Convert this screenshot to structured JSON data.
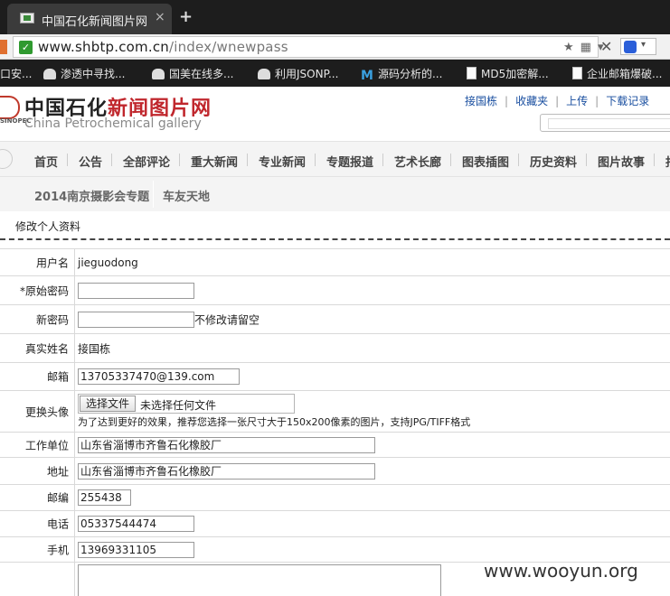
{
  "browser": {
    "tab_title": "中国石化新闻图片网",
    "tab_close": "×",
    "new_tab": "+",
    "secure_icon": "✓",
    "url_host": "www.shbtp.com.cn",
    "url_path": "/index/wnewpass",
    "bookmarks": [
      {
        "label": "口安...",
        "icon": "cloud-icon"
      },
      {
        "label": "渗透中寻找...",
        "icon": "cloud-icon"
      },
      {
        "label": "国美在线多...",
        "icon": "cloud-icon"
      },
      {
        "label": "利用JSONP...",
        "icon": "cloud-icon"
      },
      {
        "label": "源码分析的...",
        "icon": "m-icon"
      },
      {
        "label": "MD5加密解...",
        "icon": "doc-icon"
      },
      {
        "label": "企业邮箱爆破...",
        "icon": "doc-icon"
      }
    ]
  },
  "site": {
    "logo_mark": "SINOPEC",
    "logo_cn_black": "中国石化",
    "logo_cn_red": "新闻图片网",
    "logo_en": "China Petrochemical gallery",
    "top_links": [
      "接国栋",
      "收藏夹",
      "上传",
      "下载记录"
    ],
    "nav": [
      "首页",
      "公告",
      "全部评论",
      "重大新闻",
      "专业新闻",
      "专题报道",
      "艺术长廊",
      "图表插图",
      "历史资料",
      "图片故事",
      "报"
    ],
    "subnav": [
      "2014南京摄影会专题",
      "车友天地"
    ]
  },
  "page": {
    "breadcrumb": "修改个人资料",
    "fields": {
      "username_label": "用户名",
      "username_value": "jieguodong",
      "old_password_label": "*原始密码",
      "old_password_value": "",
      "new_password_label": "新密码",
      "new_password_value": "",
      "new_password_hint": "不修改请留空",
      "realname_label": "真实姓名",
      "realname_value": "接国栋",
      "email_label": "邮箱",
      "email_value": "13705337470@139.com",
      "avatar_label": "更换头像",
      "avatar_button": "选择文件",
      "avatar_status": "未选择任何文件",
      "avatar_hint": "为了达到更好的效果，推荐您选择一张尺寸大于150x200像素的图片，支持JPG/TIFF格式",
      "company_label": "工作单位",
      "company_value": "山东省淄博市齐鲁石化橡胶厂",
      "address_label": "地址",
      "address_value": "山东省淄博市齐鲁石化橡胶厂",
      "zip_label": "邮编",
      "zip_value": "255438",
      "phone_label": "电话",
      "phone_value": "05337544474",
      "mobile_label": "手机",
      "mobile_value": "13969331105"
    }
  },
  "watermark": "www.wooyun.org"
}
